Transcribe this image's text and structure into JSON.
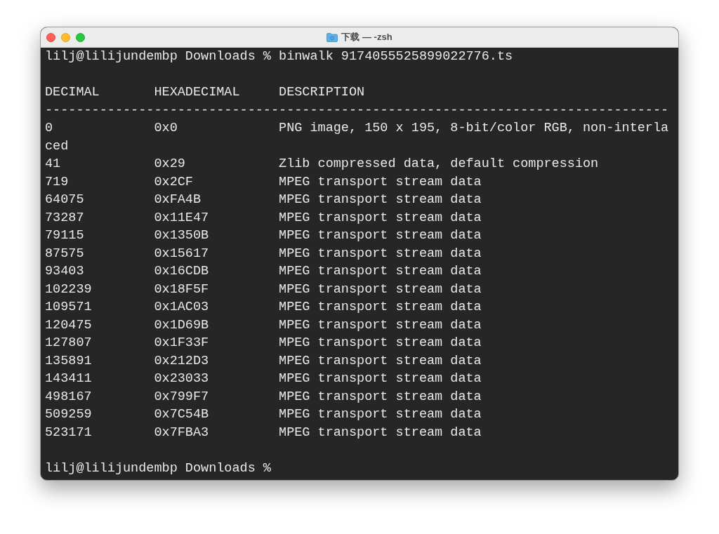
{
  "window": {
    "title": "下载 — -zsh"
  },
  "terminal": {
    "lines": [
      {
        "kind": "text",
        "text": "lilj@lilijundembp Downloads % binwalk 9174055525899022776.ts"
      },
      {
        "kind": "blank"
      },
      {
        "kind": "row",
        "cells": [
          "DECIMAL",
          "HEXADECIMAL",
          "DESCRIPTION"
        ]
      },
      {
        "kind": "text",
        "text": "--------------------------------------------------------------------------------"
      },
      {
        "kind": "row",
        "cells": [
          "0",
          "0x0",
          "PNG image, 150 x 195, 8-bit/color RGB, non-interla"
        ]
      },
      {
        "kind": "text",
        "text": "ced"
      },
      {
        "kind": "row",
        "cells": [
          "41",
          "0x29",
          "Zlib compressed data, default compression"
        ]
      },
      {
        "kind": "row",
        "cells": [
          "719",
          "0x2CF",
          "MPEG transport stream data"
        ]
      },
      {
        "kind": "row",
        "cells": [
          "64075",
          "0xFA4B",
          "MPEG transport stream data"
        ]
      },
      {
        "kind": "row",
        "cells": [
          "73287",
          "0x11E47",
          "MPEG transport stream data"
        ]
      },
      {
        "kind": "row",
        "cells": [
          "79115",
          "0x1350B",
          "MPEG transport stream data"
        ]
      },
      {
        "kind": "row",
        "cells": [
          "87575",
          "0x15617",
          "MPEG transport stream data"
        ]
      },
      {
        "kind": "row",
        "cells": [
          "93403",
          "0x16CDB",
          "MPEG transport stream data"
        ]
      },
      {
        "kind": "row",
        "cells": [
          "102239",
          "0x18F5F",
          "MPEG transport stream data"
        ]
      },
      {
        "kind": "row",
        "cells": [
          "109571",
          "0x1AC03",
          "MPEG transport stream data"
        ]
      },
      {
        "kind": "row",
        "cells": [
          "120475",
          "0x1D69B",
          "MPEG transport stream data"
        ]
      },
      {
        "kind": "row",
        "cells": [
          "127807",
          "0x1F33F",
          "MPEG transport stream data"
        ]
      },
      {
        "kind": "row",
        "cells": [
          "135891",
          "0x212D3",
          "MPEG transport stream data"
        ]
      },
      {
        "kind": "row",
        "cells": [
          "143411",
          "0x23033",
          "MPEG transport stream data"
        ]
      },
      {
        "kind": "row",
        "cells": [
          "498167",
          "0x799F7",
          "MPEG transport stream data"
        ]
      },
      {
        "kind": "row",
        "cells": [
          "509259",
          "0x7C54B",
          "MPEG transport stream data"
        ]
      },
      {
        "kind": "row",
        "cells": [
          "523171",
          "0x7FBA3",
          "MPEG transport stream data"
        ]
      },
      {
        "kind": "blank"
      },
      {
        "kind": "text",
        "text": "lilj@lilijundembp Downloads %"
      }
    ]
  }
}
